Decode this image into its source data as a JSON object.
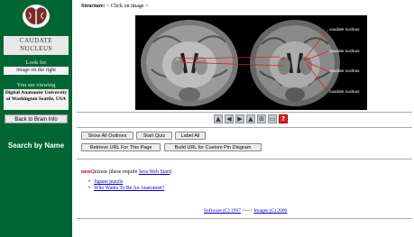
{
  "sidebar": {
    "structure_name": "CAUDATE NUCLEUS",
    "look_label": "Look for",
    "look_text": "image on the right",
    "viewing_label": "You are viewing",
    "viewing_text": "Digital Anatomist University of Washington Seattle, USA",
    "back_button": "Back to Brain Info",
    "search_by_name": "Search by Name"
  },
  "main": {
    "structure_prefix": "Structure:",
    "structure_hint": "< Click on image >",
    "mri_labels": [
      "caudate nucleus",
      "caudate nucleus",
      "caudate nucleus",
      "caudate nucleus"
    ],
    "toolbar_icons": [
      "triangle-up-icon",
      "triangle-left-icon",
      "triangle-right-icon",
      "triangle-down-icon",
      "zoom-icon",
      "page-icon",
      "question-icon"
    ],
    "buttons": {
      "show_all_outlines": "Show All Outlines",
      "start_quiz": "Start Quiz",
      "label_all": "Label All",
      "retrieve_url": "Retrieve URL For This Page",
      "build_url": "Build URL for Custom Pin Diagram"
    },
    "new_tag": "NEW",
    "quizzes_text": "Quizzes (these require",
    "quizzes_link": "Java Web Start",
    "quizzes_end": ")",
    "bullets": [
      "Jigsaw puzzle",
      "Who Wants To Be An Anatomist?"
    ],
    "footer_link1": "Software (C) 1997",
    "footer_sep": "<--->",
    "footer_link2": "Images (C) 2000"
  },
  "colors": {
    "sidebar": "#006633",
    "link": "#0000cc",
    "mri_bg": "#000000"
  }
}
